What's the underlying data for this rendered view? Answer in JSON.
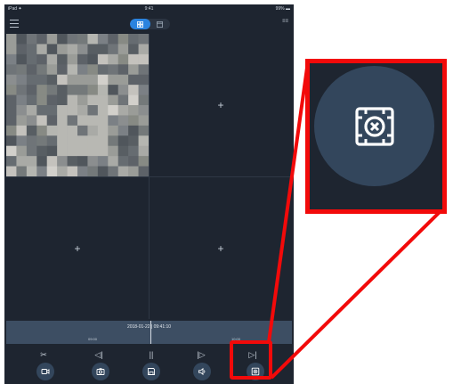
{
  "status_bar": {
    "left": "iPad ✦",
    "time": "9:41",
    "right": "99% ▬"
  },
  "top_bar": {
    "menu_icon": "hamburger-icon",
    "view_modes": [
      {
        "name": "multi-view",
        "icon": "grid-4-icon",
        "active": true
      },
      {
        "name": "single-view",
        "icon": "single-window-icon",
        "active": false
      }
    ],
    "right_label": "≡≡"
  },
  "grid": {
    "panes": [
      {
        "state": "playing",
        "content": "pixelated video feed"
      },
      {
        "state": "empty",
        "plus": "+"
      },
      {
        "state": "empty",
        "plus": "+"
      },
      {
        "state": "empty",
        "plus": "+"
      }
    ]
  },
  "timeline": {
    "readout": "2018-01-22 | 09:41:10",
    "scale_left": "09:00",
    "scale_right": "10:00"
  },
  "controls": {
    "row1": [
      {
        "name": "cut",
        "glyph": "✂"
      },
      {
        "name": "previous-frame",
        "glyph": "◁|"
      },
      {
        "name": "pause",
        "glyph": "||"
      },
      {
        "name": "next-frame",
        "glyph": "|▷"
      },
      {
        "name": "skip-to-end",
        "glyph": "▷|"
      }
    ],
    "row2": [
      {
        "name": "record",
        "icon": "video-camera-icon"
      },
      {
        "name": "screenshot",
        "icon": "camera-icon"
      },
      {
        "name": "save",
        "icon": "floppy-disk-icon"
      },
      {
        "name": "audio",
        "icon": "speaker-icon"
      },
      {
        "name": "stop-all",
        "icon": "window-close-icon"
      }
    ]
  },
  "callout": {
    "icon": "window-close-icon",
    "color": "#f20a0a"
  },
  "colors": {
    "background": "#1e2530",
    "accent": "#2a83df",
    "timeline": "#3d4e63",
    "button": "#33465c"
  }
}
